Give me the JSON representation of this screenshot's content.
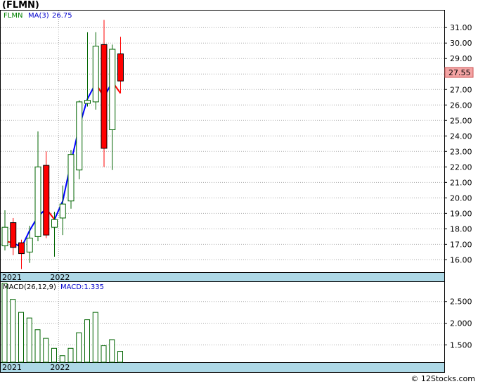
{
  "header": {
    "title": "(FLMN)"
  },
  "footer": {
    "copyright": "© 12Stocks.com"
  },
  "chart_data": [
    {
      "type": "candlestick",
      "legend": {
        "symbol": "FLMN",
        "ma_label": "MA(3)",
        "ma_value": "26.75"
      },
      "last_price": "27.55",
      "y_ticks": [
        "16.00",
        "17.00",
        "18.00",
        "19.00",
        "20.00",
        "21.00",
        "22.00",
        "23.00",
        "24.00",
        "25.00",
        "26.00",
        "27.00",
        "28.00",
        "29.00",
        "30.00",
        "31.00"
      ],
      "x_labels": [
        {
          "label": "2021",
          "index": 0
        },
        {
          "label": "2022",
          "index": 7
        }
      ],
      "ylim": [
        15.2,
        32.1
      ],
      "candles": [
        {
          "o": 16.9,
          "h": 19.2,
          "l": 16.6,
          "c": 18.1
        },
        {
          "o": 18.4,
          "h": 18.7,
          "l": 16.3,
          "c": 16.8
        },
        {
          "o": 17.1,
          "h": 17.3,
          "l": 15.4,
          "c": 16.4
        },
        {
          "o": 16.5,
          "h": 18.2,
          "l": 15.8,
          "c": 17.4
        },
        {
          "o": 17.5,
          "h": 24.3,
          "l": 17.2,
          "c": 22.0
        },
        {
          "o": 22.1,
          "h": 23.0,
          "l": 17.4,
          "c": 17.6
        },
        {
          "o": 18.1,
          "h": 19.1,
          "l": 16.2,
          "c": 18.6
        },
        {
          "o": 18.7,
          "h": 20.8,
          "l": 17.6,
          "c": 19.6
        },
        {
          "o": 19.8,
          "h": 23.1,
          "l": 19.3,
          "c": 22.8
        },
        {
          "o": 21.8,
          "h": 26.3,
          "l": 21.2,
          "c": 26.2
        },
        {
          "o": 26.1,
          "h": 30.7,
          "l": 25.9,
          "c": 26.3
        },
        {
          "o": 26.2,
          "h": 30.7,
          "l": 25.7,
          "c": 29.8
        },
        {
          "o": 29.9,
          "h": 31.5,
          "l": 22.0,
          "c": 23.2
        },
        {
          "o": 24.4,
          "h": 29.9,
          "l": 21.8,
          "c": 29.6
        },
        {
          "o": 29.3,
          "h": 30.4,
          "l": 26.8,
          "c": 27.55
        }
      ],
      "ma": [
        17.2,
        17.1,
        16.8,
        17.9,
        18.8,
        19.3,
        18.6,
        19.8,
        22.3,
        24.6,
        26.4,
        27.4,
        26.5,
        27.5,
        26.75
      ],
      "ma_colors": [
        "#0000ff",
        "#ff0000",
        "#0000ff",
        "#0000ff",
        "#0000ff",
        "#0000ff",
        "#ff0000",
        "#0000ff",
        "#0000ff",
        "#0000ff",
        "#0000ff",
        "#0000ff",
        "#ff0000",
        "#0000ff",
        "#ff0000"
      ],
      "colors": {
        "up": "#006400",
        "down": "#ff0000",
        "axis_band": "#add8e6",
        "grid": "#aaaaaa"
      }
    },
    {
      "type": "bar",
      "legend": {
        "label": "MACD(26,12,9)",
        "value_label": "MACD:1.335"
      },
      "y_ticks": [
        "1.500",
        "2.000",
        "2.500"
      ],
      "ylim": [
        1.1,
        2.95
      ],
      "x_labels": [
        {
          "label": "2021",
          "index": 0
        },
        {
          "label": "2022",
          "index": 7
        }
      ],
      "values": [
        2.92,
        2.55,
        2.25,
        2.12,
        1.85,
        1.65,
        1.42,
        1.25,
        1.42,
        1.78,
        2.08,
        2.25,
        1.48,
        1.62,
        1.35
      ]
    }
  ]
}
